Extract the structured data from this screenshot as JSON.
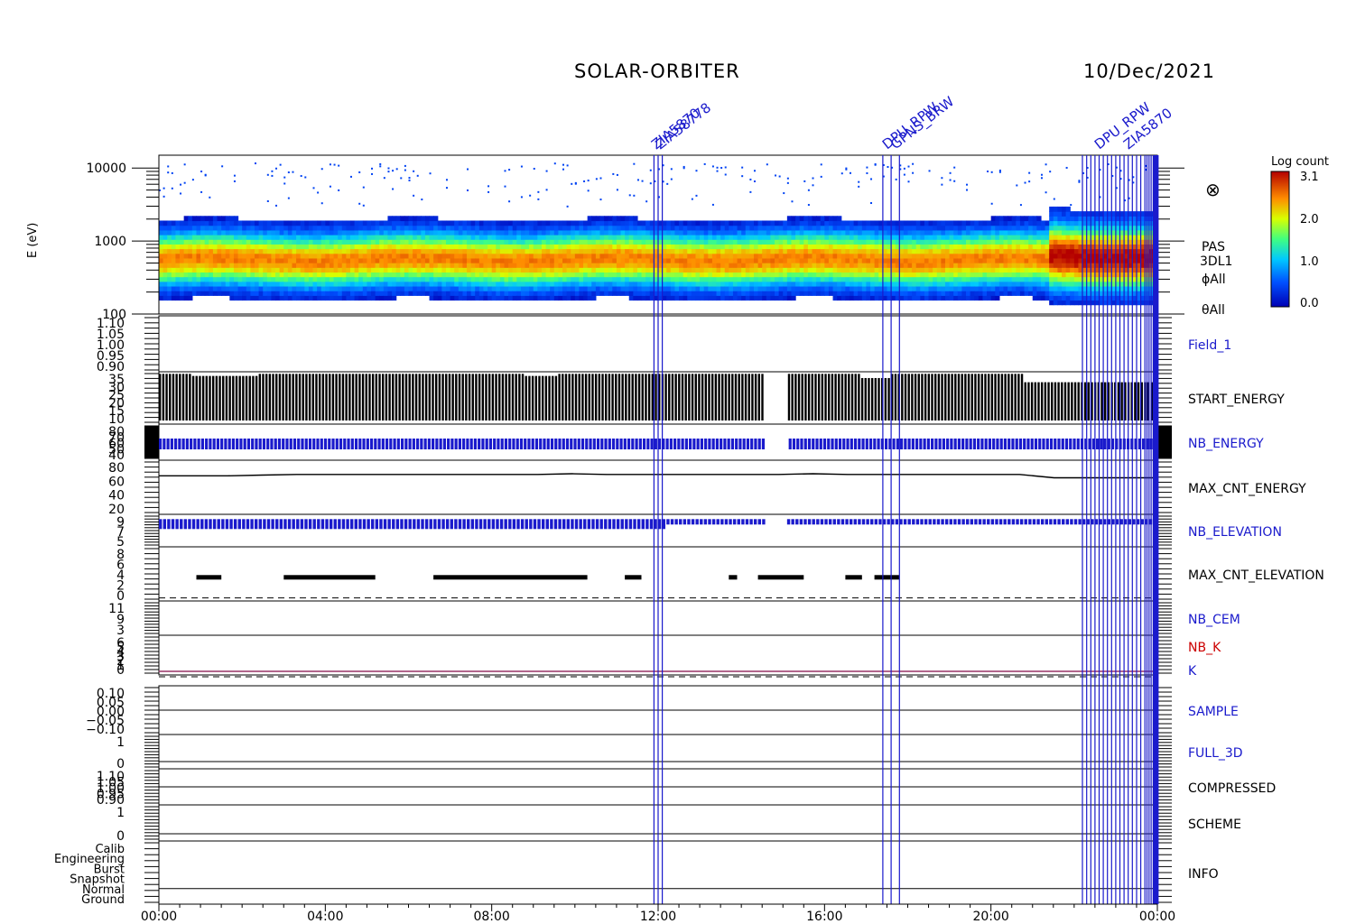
{
  "header": {
    "title": "SOLAR-ORBITER",
    "date": "10/Dec/2021"
  },
  "spectrogram": {
    "ylabel": "E (eV)",
    "yticks": [
      "10000",
      "1000",
      "100"
    ],
    "yrange": [
      100,
      15000
    ],
    "yscale": "log",
    "labels": [
      "PAS",
      "3DL1",
      "ϕAll",
      "θAll"
    ],
    "symbol": "⊗",
    "colorbar": {
      "title": "Log count",
      "ticks": [
        "3.1",
        "2.0",
        "1.0",
        "0.0"
      ],
      "range": [
        0.0,
        3.1
      ]
    }
  },
  "chart_data": {
    "type": "line",
    "xaxis": {
      "ticks": [
        "00:00",
        "04:00",
        "08:00",
        "12:00",
        "16:00",
        "20:00",
        "00:00"
      ],
      "range_hours": [
        0,
        24
      ]
    },
    "event_lines": {
      "color": "#1a1acc",
      "hours": [
        11.9,
        12.0,
        12.1,
        17.4,
        17.6,
        17.8,
        22.2,
        22.3,
        22.4,
        22.5,
        22.6,
        22.7,
        22.8,
        22.9,
        23.0,
        23.1,
        23.2,
        23.3,
        23.4,
        23.5,
        23.6,
        23.7,
        23.75,
        23.8,
        23.85,
        23.9,
        23.95
      ],
      "labels": [
        "ZIA5870",
        "ZIA58778",
        "DPU_RPW",
        "GPNS_BRW",
        "DPU_RPW",
        "ZIA5870"
      ]
    },
    "panels": [
      {
        "name": "Field_1",
        "label_color": "#1a1acc",
        "yticks": [
          "1.10",
          "1.05",
          "1.00",
          "0.95",
          "0.90"
        ],
        "ylim": [
          0.9,
          1.1
        ]
      },
      {
        "name": "START_ENERGY",
        "label_color": "#000000",
        "yticks": [
          "35",
          "30",
          "25",
          "20",
          "15",
          "10"
        ],
        "ylim": [
          10,
          35
        ],
        "values": [
          34,
          33,
          33,
          34,
          34,
          34,
          34,
          34,
          34,
          34,
          34,
          33,
          34,
          34,
          34,
          34,
          34,
          34,
          34,
          34,
          34,
          32,
          34,
          34,
          34,
          34,
          30,
          30,
          30,
          30
        ]
      },
      {
        "name": "NB_ENERGY",
        "label_color": "#1a1acc",
        "yticks": [
          "80",
          "70",
          "60",
          "50",
          "40"
        ],
        "ylim": [
          40,
          80
        ],
        "values": [
          58,
          58,
          58,
          58,
          58,
          58,
          58,
          58,
          58,
          58,
          58,
          58,
          58,
          58,
          58,
          58,
          58,
          58,
          58,
          58,
          58,
          58,
          58,
          58,
          58,
          58,
          58,
          58,
          58,
          58
        ]
      },
      {
        "name": "MAX_CNT_ENERGY",
        "label_color": "#000000",
        "yticks": [
          "80",
          "60",
          "40",
          "20"
        ],
        "ylim": [
          0,
          80
        ],
        "values": [
          57,
          57,
          57,
          58,
          59,
          59,
          59,
          59,
          59,
          59,
          59,
          59,
          60,
          59,
          59,
          59,
          59,
          59,
          59,
          60,
          59,
          59,
          59,
          59,
          59,
          59,
          54,
          54,
          54,
          54
        ]
      },
      {
        "name": "NB_ELEVATION",
        "label_color": "#1a1acc",
        "yticks": [
          "9",
          "7",
          "5"
        ],
        "ylim": [
          3,
          10
        ],
        "values": [
          8,
          8,
          8,
          8,
          8,
          8,
          8,
          8,
          8,
          8,
          8,
          8,
          8,
          8,
          8,
          8,
          8,
          8,
          8,
          8,
          8,
          8,
          8,
          8,
          8,
          8,
          8,
          8,
          8,
          8
        ]
      },
      {
        "name": "MAX_CNT_ELEVATION",
        "label_color": "#000000",
        "yticks": [
          "8",
          "6",
          "4",
          "2",
          "0"
        ],
        "ylim": [
          0,
          9
        ]
      },
      {
        "name": "NB_CEM",
        "label_color": "#1a1acc",
        "yticks": [
          "11",
          "9",
          "3"
        ],
        "ylim": [
          0,
          12
        ]
      },
      {
        "name": "NB_K",
        "label_color": "#cc0000",
        "yticks": [
          "6",
          "5",
          "4",
          "3",
          "2",
          "1",
          "0"
        ],
        "ylim": [
          0,
          6
        ]
      },
      {
        "name": "K",
        "label_color": "#1a1acc",
        "yticks": [],
        "ylim": [
          0,
          6
        ]
      },
      {
        "name": "SAMPLE",
        "label_color": "#1a1acc",
        "yticks": [
          "0.10",
          "0.05",
          "0.00",
          "−0.05",
          "−0.10"
        ],
        "ylim": [
          -0.1,
          0.1
        ]
      },
      {
        "name": "FULL_3D",
        "label_color": "#1a1acc",
        "yticks": [
          "1",
          "0"
        ],
        "ylim": [
          0,
          1
        ]
      },
      {
        "name": "COMPRESSED",
        "label_color": "#000000",
        "yticks": [
          "1.10",
          "1.05",
          "1.00",
          "0.95",
          "0.90"
        ],
        "ylim": [
          0.9,
          1.1
        ]
      },
      {
        "name": "SCHEME",
        "label_color": "#000000",
        "yticks": [
          "1",
          "0"
        ],
        "ylim": [
          0,
          1
        ]
      },
      {
        "name": "INFO",
        "label_color": "#000000",
        "yticks": [
          "Calib",
          "Engineering",
          "Burst",
          "Snapshot",
          "Normal",
          "Ground"
        ],
        "ylim": [
          0,
          5
        ]
      }
    ]
  }
}
